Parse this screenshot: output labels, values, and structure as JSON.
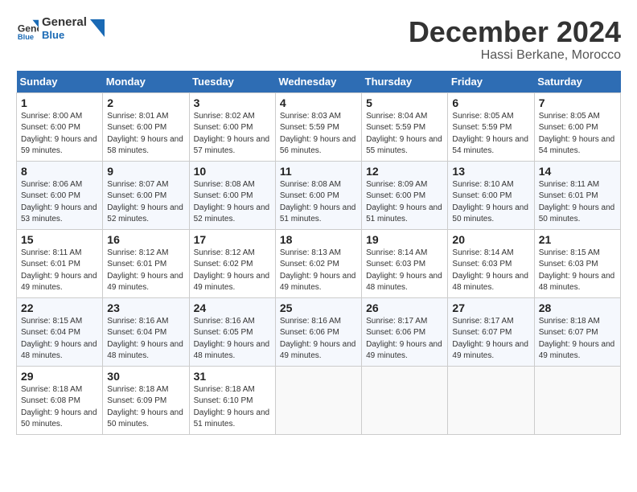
{
  "logo": {
    "line1": "General",
    "line2": "Blue"
  },
  "title": "December 2024",
  "subtitle": "Hassi Berkane, Morocco",
  "days_header": [
    "Sunday",
    "Monday",
    "Tuesday",
    "Wednesday",
    "Thursday",
    "Friday",
    "Saturday"
  ],
  "weeks": [
    [
      {
        "day": "1",
        "sunrise": "8:00 AM",
        "sunset": "6:00 PM",
        "daylight": "9 hours and 59 minutes."
      },
      {
        "day": "2",
        "sunrise": "8:01 AM",
        "sunset": "6:00 PM",
        "daylight": "9 hours and 58 minutes."
      },
      {
        "day": "3",
        "sunrise": "8:02 AM",
        "sunset": "6:00 PM",
        "daylight": "9 hours and 57 minutes."
      },
      {
        "day": "4",
        "sunrise": "8:03 AM",
        "sunset": "5:59 PM",
        "daylight": "9 hours and 56 minutes."
      },
      {
        "day": "5",
        "sunrise": "8:04 AM",
        "sunset": "5:59 PM",
        "daylight": "9 hours and 55 minutes."
      },
      {
        "day": "6",
        "sunrise": "8:05 AM",
        "sunset": "5:59 PM",
        "daylight": "9 hours and 54 minutes."
      },
      {
        "day": "7",
        "sunrise": "8:05 AM",
        "sunset": "6:00 PM",
        "daylight": "9 hours and 54 minutes."
      }
    ],
    [
      {
        "day": "8",
        "sunrise": "8:06 AM",
        "sunset": "6:00 PM",
        "daylight": "9 hours and 53 minutes."
      },
      {
        "day": "9",
        "sunrise": "8:07 AM",
        "sunset": "6:00 PM",
        "daylight": "9 hours and 52 minutes."
      },
      {
        "day": "10",
        "sunrise": "8:08 AM",
        "sunset": "6:00 PM",
        "daylight": "9 hours and 52 minutes."
      },
      {
        "day": "11",
        "sunrise": "8:08 AM",
        "sunset": "6:00 PM",
        "daylight": "9 hours and 51 minutes."
      },
      {
        "day": "12",
        "sunrise": "8:09 AM",
        "sunset": "6:00 PM",
        "daylight": "9 hours and 51 minutes."
      },
      {
        "day": "13",
        "sunrise": "8:10 AM",
        "sunset": "6:00 PM",
        "daylight": "9 hours and 50 minutes."
      },
      {
        "day": "14",
        "sunrise": "8:11 AM",
        "sunset": "6:01 PM",
        "daylight": "9 hours and 50 minutes."
      }
    ],
    [
      {
        "day": "15",
        "sunrise": "8:11 AM",
        "sunset": "6:01 PM",
        "daylight": "9 hours and 49 minutes."
      },
      {
        "day": "16",
        "sunrise": "8:12 AM",
        "sunset": "6:01 PM",
        "daylight": "9 hours and 49 minutes."
      },
      {
        "day": "17",
        "sunrise": "8:12 AM",
        "sunset": "6:02 PM",
        "daylight": "9 hours and 49 minutes."
      },
      {
        "day": "18",
        "sunrise": "8:13 AM",
        "sunset": "6:02 PM",
        "daylight": "9 hours and 49 minutes."
      },
      {
        "day": "19",
        "sunrise": "8:14 AM",
        "sunset": "6:03 PM",
        "daylight": "9 hours and 48 minutes."
      },
      {
        "day": "20",
        "sunrise": "8:14 AM",
        "sunset": "6:03 PM",
        "daylight": "9 hours and 48 minutes."
      },
      {
        "day": "21",
        "sunrise": "8:15 AM",
        "sunset": "6:03 PM",
        "daylight": "9 hours and 48 minutes."
      }
    ],
    [
      {
        "day": "22",
        "sunrise": "8:15 AM",
        "sunset": "6:04 PM",
        "daylight": "9 hours and 48 minutes."
      },
      {
        "day": "23",
        "sunrise": "8:16 AM",
        "sunset": "6:04 PM",
        "daylight": "9 hours and 48 minutes."
      },
      {
        "day": "24",
        "sunrise": "8:16 AM",
        "sunset": "6:05 PM",
        "daylight": "9 hours and 48 minutes."
      },
      {
        "day": "25",
        "sunrise": "8:16 AM",
        "sunset": "6:06 PM",
        "daylight": "9 hours and 49 minutes."
      },
      {
        "day": "26",
        "sunrise": "8:17 AM",
        "sunset": "6:06 PM",
        "daylight": "9 hours and 49 minutes."
      },
      {
        "day": "27",
        "sunrise": "8:17 AM",
        "sunset": "6:07 PM",
        "daylight": "9 hours and 49 minutes."
      },
      {
        "day": "28",
        "sunrise": "8:18 AM",
        "sunset": "6:07 PM",
        "daylight": "9 hours and 49 minutes."
      }
    ],
    [
      {
        "day": "29",
        "sunrise": "8:18 AM",
        "sunset": "6:08 PM",
        "daylight": "9 hours and 50 minutes."
      },
      {
        "day": "30",
        "sunrise": "8:18 AM",
        "sunset": "6:09 PM",
        "daylight": "9 hours and 50 minutes."
      },
      {
        "day": "31",
        "sunrise": "8:18 AM",
        "sunset": "6:10 PM",
        "daylight": "9 hours and 51 minutes."
      },
      null,
      null,
      null,
      null
    ]
  ]
}
